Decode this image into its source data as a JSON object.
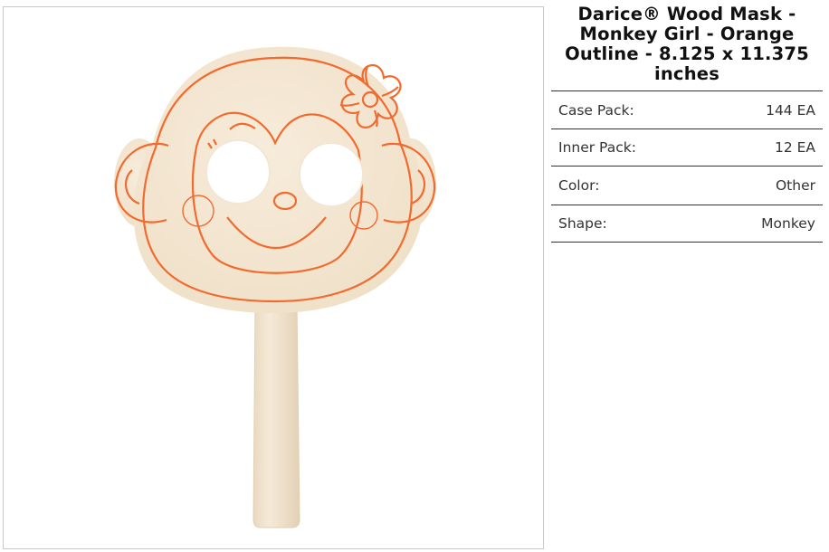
{
  "product": {
    "title": "Darice® Wood Mask - Monkey Girl - Orange Outline - 8.125 x 11.375 inches",
    "image_alt": "wood-mask-monkey-girl-photo"
  },
  "specs": [
    {
      "label": "Case Pack:",
      "value": "144 EA"
    },
    {
      "label": "Inner Pack:",
      "value": "12 EA"
    },
    {
      "label": "Color:",
      "value": "Other"
    },
    {
      "label": "Shape:",
      "value": "Monkey"
    }
  ],
  "colors": {
    "wood": "#f3e6d1",
    "outline": "#f26a2e",
    "border": "#333333"
  }
}
